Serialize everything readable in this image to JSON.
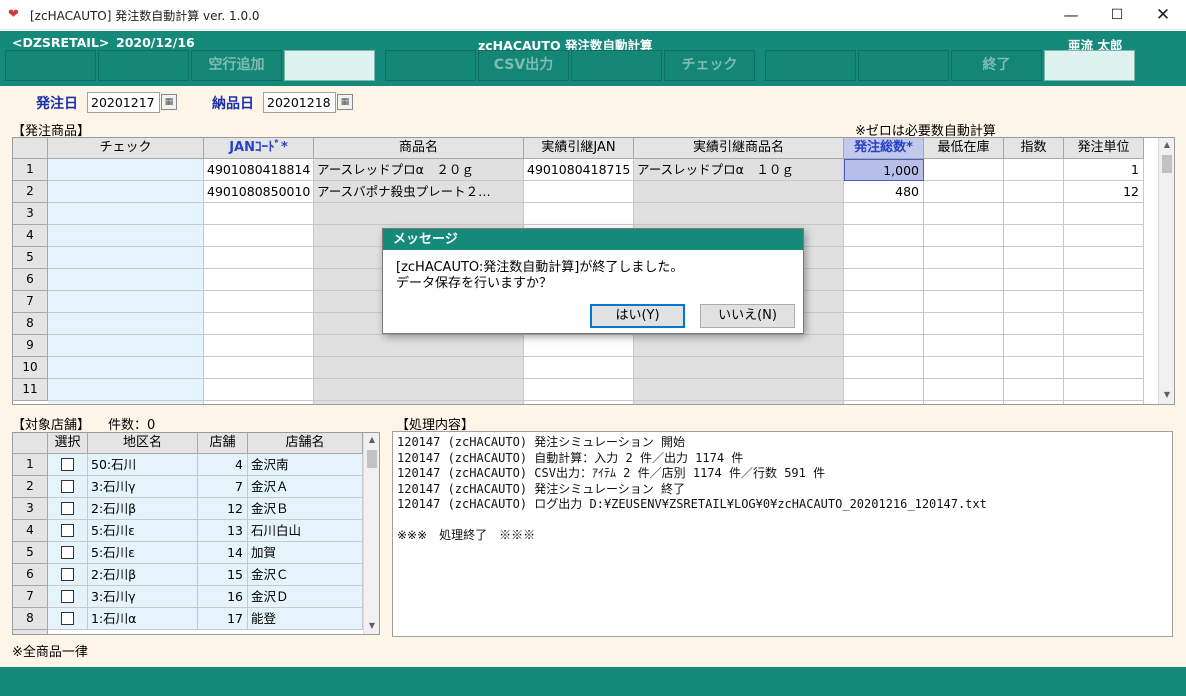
{
  "window": {
    "title": "[zcHACAUTO] 発注数自動計算 ver. 1.0.0",
    "minimize": "—",
    "maximize": "☐",
    "close": "✕"
  },
  "header": {
    "company": "<DZSRETAIL>",
    "date": "2020/12/16",
    "program": "zcHACAUTO 発注数自動計算",
    "user": "亜流 太郎"
  },
  "function_keys": [
    "",
    "",
    "空行追加",
    "",
    "",
    "CSV出力",
    "",
    "チェック",
    "",
    "",
    "終了"
  ],
  "dates": {
    "order_label": "発注日",
    "order_value": "20201217",
    "delivery_label": "納品日",
    "delivery_value": "20201218"
  },
  "products": {
    "section_label": "【発注商品】",
    "note": "※ゼロは必要数自動計算",
    "columns": [
      "チェック",
      "JANｺｰﾄﾞ*",
      "商品名",
      "実績引継JAN",
      "実績引継商品名",
      "発注総数*",
      "最低在庫",
      "指数",
      "発注単位"
    ],
    "row_numbers": [
      "1",
      "2",
      "3",
      "4",
      "5",
      "6",
      "7",
      "8",
      "9",
      "10",
      "11"
    ],
    "rows": [
      {
        "check": "",
        "jan": "4901080418814",
        "name": "アースレッドプロα　２０ｇ",
        "inherit_jan": "4901080418715",
        "inherit_name": "アースレッドプロα　１０ｇ",
        "total": "1,000",
        "min_stock": "",
        "index": "",
        "unit": "1"
      },
      {
        "check": "",
        "jan": "4901080850010",
        "name": "アースバポナ殺虫プレート２…",
        "inherit_jan": "",
        "inherit_name": "",
        "total": "480",
        "min_stock": "",
        "index": "",
        "unit": "12"
      }
    ]
  },
  "stores": {
    "section_label": "【対象店舗】",
    "count_label": "件数：0",
    "columns": [
      "選択",
      "地区名",
      "店舗",
      "店舗名"
    ],
    "rows": [
      {
        "no": "1",
        "area": "50:石川",
        "store": "4",
        "name": "金沢南"
      },
      {
        "no": "2",
        "area": "3:石川γ",
        "store": "7",
        "name": "金沢Ａ"
      },
      {
        "no": "3",
        "area": "2:石川β",
        "store": "12",
        "name": "金沢Ｂ"
      },
      {
        "no": "4",
        "area": "5:石川ε",
        "store": "13",
        "name": "石川白山"
      },
      {
        "no": "5",
        "area": "5:石川ε",
        "store": "14",
        "name": "加賀"
      },
      {
        "no": "6",
        "area": "2:石川β",
        "store": "15",
        "name": "金沢Ｃ"
      },
      {
        "no": "7",
        "area": "3:石川γ",
        "store": "16",
        "name": "金沢Ｄ"
      },
      {
        "no": "8",
        "area": "1:石川α",
        "store": "17",
        "name": "能登"
      }
    ],
    "footnote": "※全商品一律"
  },
  "process": {
    "section_label": "【処理内容】",
    "log": "120147 (zcHACAUTO) 発注シミュレーション 開始\n120147 (zcHACAUTO) 自動計算：入力 2 件／出力 1174 件\n120147 (zcHACAUTO) CSV出力：ｱｲﾃﾑ 2 件／店別 1174 件／行数 591 件\n120147 (zcHACAUTO) 発注シミュレーション 終了\n120147 (zcHACAUTO) ログ出力 D:¥ZEUSENV¥ZSRETAIL¥LOG¥0¥zcHACAUTO_20201216_120147.txt\n\n※※※　処理終了　※※※"
  },
  "dialog": {
    "title": "メッセージ",
    "message": "[zcHACAUTO:発注数自動計算]が終了しました。\nデータ保存を行いますか？",
    "yes": "はい(Y)",
    "no": "いいえ(N)"
  },
  "colors": {
    "header_teal": "#158a7b",
    "jan_header_blue": "#2741c8",
    "selected_cell": "#b7bfe9",
    "check_column": "#e4f3fc",
    "readonly_gray": "#e0e0e0"
  }
}
